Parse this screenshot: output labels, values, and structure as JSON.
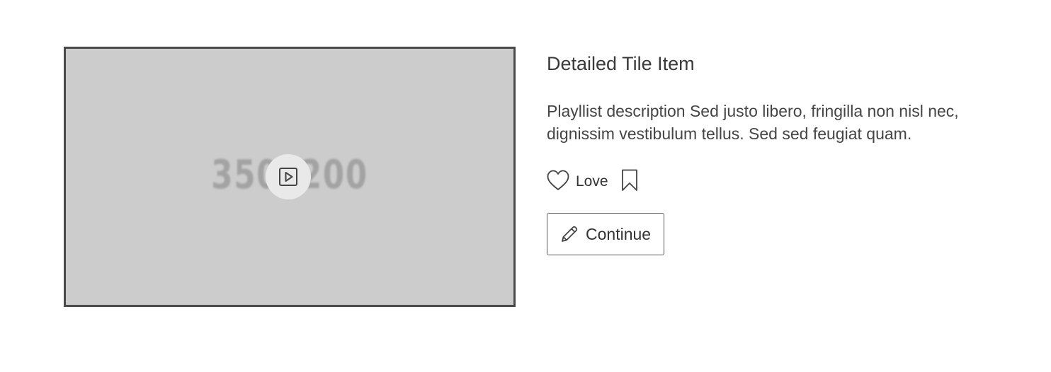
{
  "thumbnail": {
    "placeholder_text": "350x200",
    "play_icon": "play-icon"
  },
  "tile": {
    "title": "Detailed Tile Item",
    "description": "Playllist description Sed justo libero, fringilla non nisl nec, dignissim vestibulum tellus. Sed sed feugiat quam."
  },
  "actions": {
    "love_label": "Love",
    "love_icon": "heart-icon",
    "bookmark_icon": "bookmark-icon"
  },
  "continue_button": {
    "label": "Continue",
    "icon": "pencil-icon"
  },
  "colors": {
    "border": "#4a4a4a",
    "thumb_bg": "#cccccc",
    "text": "#333333"
  }
}
